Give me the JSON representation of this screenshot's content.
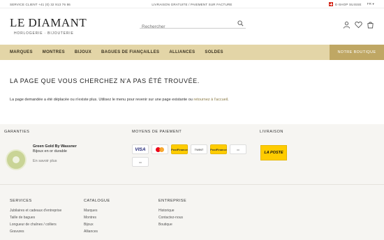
{
  "topbar": {
    "service": "SERVICE CLIENT +41 (0) 32 913 76 86",
    "shipping": "LIVRAISON GRATUITE / PAIEMENT SUR FACTURE",
    "shop": "E-SHOP SUISSE",
    "lang": "FR"
  },
  "header": {
    "logo_name": "LE DIAMANT",
    "logo_tagline": "HORLOGERIE · BIJOUTERIE",
    "search_placeholder": "Rechercher"
  },
  "nav": {
    "items": [
      "MARQUES",
      "MONTRES",
      "BIJOUX",
      "BAGUES DE FIANÇAILLES",
      "ALLIANCES",
      "SOLDES"
    ],
    "shop_button": "NOTRE BOUTIQUE"
  },
  "error": {
    "title": "LA PAGE QUE VOUS CHERCHEZ N'A PAS ÉTÉ TROUVÉE.",
    "text": "La page demandée a été déplacée ou n'existe plus. Utilisez le menu pour revenir sur une page existante ou ",
    "link": "retournez à l'accueil",
    "end": "."
  },
  "footer": {
    "guarantees": {
      "title": "GARANTIES",
      "badge_title": "Green Gold By Wassner",
      "badge_subtitle": "Bijoux en or durable",
      "more": "En savoir plus"
    },
    "payment": {
      "title": "MOYENS DE PAIEMENT",
      "methods": [
        "VISA",
        "Mastercard",
        "PostFinance E-Finance",
        "TWINT",
        "PostFinance Card",
        "Invoice",
        "Invoice"
      ]
    },
    "delivery": {
      "title": "LIVRAISON",
      "carrier": "LA POSTE"
    },
    "columns": [
      {
        "title": "SERVICES",
        "links": [
          "Jubilaires et cadeaux d'entreprise",
          "Taille de bagues",
          "Longueur de chaînes / colliers",
          "Gravures"
        ]
      },
      {
        "title": "CATALOGUE",
        "links": [
          "Marques",
          "Montres",
          "Bijoux",
          "Alliances"
        ]
      },
      {
        "title": "ENTREPRISE",
        "links": [
          "Historique",
          "Contactez-nous",
          "Boutique"
        ]
      }
    ]
  }
}
